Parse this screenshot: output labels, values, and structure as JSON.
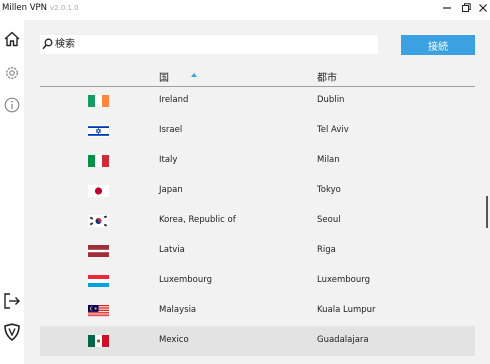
{
  "app": {
    "title": "Millen VPN",
    "version": "v2.0.1.0"
  },
  "colors": {
    "accent": "#3ba1e0",
    "panel": "#f2f2f2",
    "selected_row": "#e3e3e3"
  },
  "sidebar": {
    "top_icons": [
      "home-icon",
      "gear-icon",
      "info-icon"
    ],
    "bottom_icons": [
      "logout-icon",
      "shield-icon"
    ]
  },
  "search": {
    "placeholder": "検索",
    "value": ""
  },
  "connect_label": "接続",
  "table": {
    "headers": {
      "country": "国",
      "city": "都市"
    },
    "sort": "country-ascending",
    "rows": [
      {
        "flag": "ireland-flag-icon",
        "country": "Ireland",
        "city": "Dublin",
        "selected": false
      },
      {
        "flag": "israel-flag-icon",
        "country": "Israel",
        "city": "Tel Aviv",
        "selected": false
      },
      {
        "flag": "italy-flag-icon",
        "country": "Italy",
        "city": "Milan",
        "selected": false
      },
      {
        "flag": "japan-flag-icon",
        "country": "Japan",
        "city": "Tokyo",
        "selected": false
      },
      {
        "flag": "korea-flag-icon",
        "country": "Korea, Republic of",
        "city": "Seoul",
        "selected": false
      },
      {
        "flag": "latvia-flag-icon",
        "country": "Latvia",
        "city": "Riga",
        "selected": false
      },
      {
        "flag": "luxembourg-flag-icon",
        "country": "Luxembourg",
        "city": "Luxembourg",
        "selected": false
      },
      {
        "flag": "malaysia-flag-icon",
        "country": "Malaysia",
        "city": "Kuala Lumpur",
        "selected": false
      },
      {
        "flag": "mexico-flag-icon",
        "country": "Mexico",
        "city": "Guadalajara",
        "selected": true
      }
    ]
  }
}
